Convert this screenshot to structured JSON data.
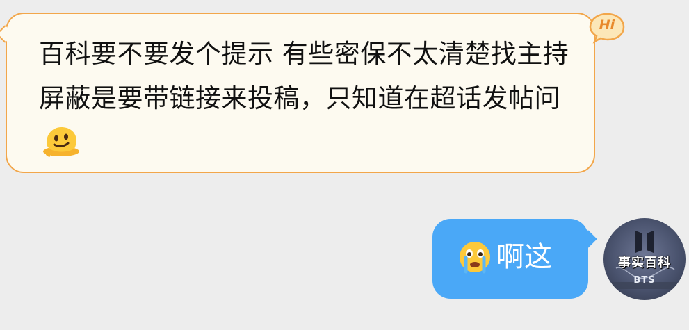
{
  "chat": {
    "incoming": {
      "text": "百科要不要发个提示 有些密保不太清楚找主持屏蔽是要带链接来投稿，只知道在超话发帖问",
      "emoji": "melting-face-emoji",
      "badge": "Hi"
    },
    "outgoing": {
      "text": "啊这",
      "emoji": "crying-face-emoji"
    },
    "avatar": {
      "title": "事实百科",
      "subtitle": "BTS"
    }
  },
  "colors": {
    "background": "#ededed",
    "incoming_bubble": "#fdfaf0",
    "incoming_border": "#f2a64a",
    "outgoing_bubble": "#4aa8f7"
  }
}
